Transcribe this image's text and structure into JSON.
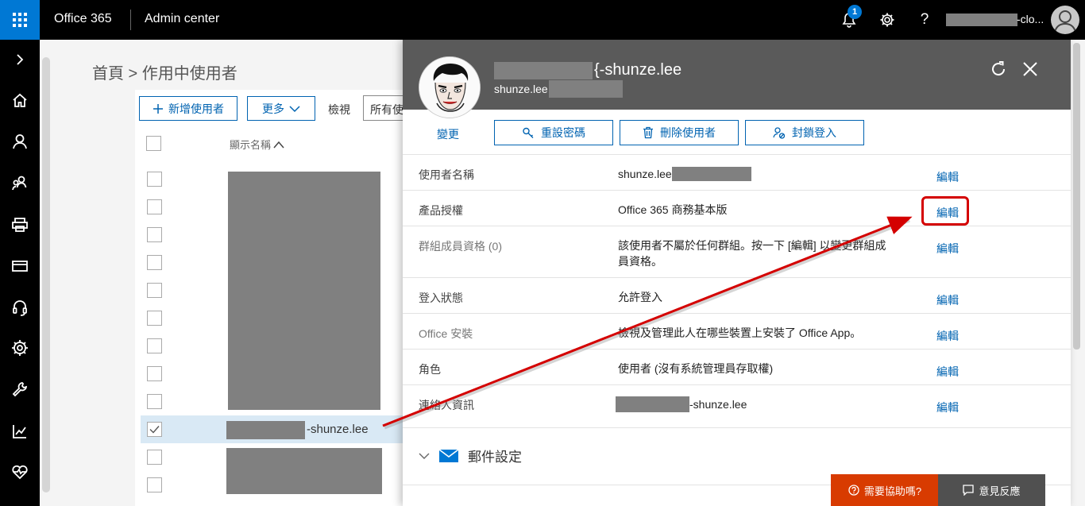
{
  "topbar": {
    "brand": "Office 365",
    "app_title": "Admin center",
    "notification_count": "1",
    "help_glyph": "?",
    "account_suffix": "-clo...",
    "icons": [
      "app-launcher-icon",
      "bell-icon",
      "gear-icon",
      "help-icon",
      "user-avatar-icon"
    ]
  },
  "leftnav": {
    "icons": [
      "chevron-right-icon",
      "home-icon",
      "user-icon",
      "groups-icon",
      "resources-icon",
      "billing-icon",
      "support-icon",
      "settings-icon",
      "setup-icon",
      "reports-icon",
      "health-icon"
    ]
  },
  "breadcrumb": "首頁 > 作用中使用者",
  "toolbar": {
    "add_user": "新增使用者",
    "more": "更多",
    "view_label": "檢視",
    "view_value": "所有使用者"
  },
  "list": {
    "column_header": "顯示名稱",
    "selected_user_suffix": "-shunze.lee"
  },
  "panel": {
    "name_suffix": "{-shunze.lee",
    "email_prefix": "shunze.lee",
    "change_photo": "變更",
    "actions": {
      "reset_password": "重設密碼",
      "delete_user": "刪除使用者",
      "block_signin": "封鎖登入"
    },
    "properties": [
      {
        "label": "使用者名稱",
        "value": "shunze.lee",
        "edit": "編輯"
      },
      {
        "label": "產品授權",
        "value": "Office 365 商務基本版",
        "edit": "編輯"
      },
      {
        "label": "群組成員資格 (0)",
        "value": "該使用者不屬於任何群組。按一下 [編輯] 以變更群組成員資格。",
        "edit": "編輯"
      },
      {
        "label": "登入狀態",
        "value": "允許登入",
        "edit": "編輯"
      },
      {
        "label": "Office 安裝",
        "value": "檢視及管理此人在哪些裝置上安裝了 Office App。",
        "edit": "編輯"
      },
      {
        "label": "角色",
        "value": "使用者 (沒有系統管理員存取權)",
        "edit": "編輯"
      },
      {
        "label": "連絡人資訊",
        "value": "-shunze.lee",
        "edit": "編輯"
      }
    ],
    "mail_settings": "郵件設定"
  },
  "footer": {
    "need_help": "需要協助嗎?",
    "feedback": "意見反應"
  },
  "colors": {
    "accent": "#0078d4",
    "link": "#0063b1",
    "annotation": "#d40000",
    "help_button": "#d83b01"
  }
}
